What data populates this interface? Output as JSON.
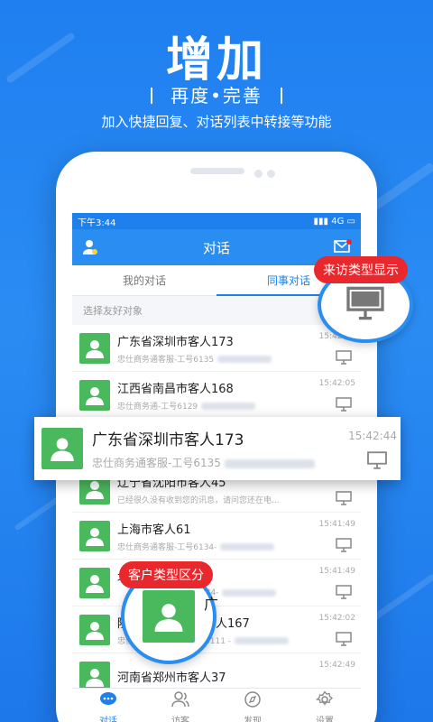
{
  "promo": {
    "title": "增加",
    "subtitle": "再度•完善",
    "description": "加入快捷回复、对话列表中转接等功能"
  },
  "status": {
    "time": "下午3:44",
    "network": "4G"
  },
  "appbar": {
    "title": "对话"
  },
  "tabs": [
    {
      "label": "我的对话",
      "active": false
    },
    {
      "label": "同事对话",
      "active": true
    }
  ],
  "filter": {
    "placeholder": "选择友好对象"
  },
  "conversations": [
    {
      "name": "广东省深圳市客人173",
      "detail": "忠仕商务通客服-工号6135",
      "time": "15:42:44"
    },
    {
      "name": "江西省南昌市客人168",
      "detail": "忠仕商务通-工号6129",
      "time": "15:42:05"
    },
    {
      "name": "辽宁省沈阳市客人45",
      "detail": "已经很久没有收到您的讯息，请问您还在电...",
      "time": "15:42:21"
    },
    {
      "name": "上海市客人61",
      "detail": "忠仕商务通客服-工号6134-",
      "time": "15:41:49"
    },
    {
      "name": "北",
      "detail": "",
      "time": "15:41:49"
    },
    {
      "name": "陕",
      "detail": "忠仕商",
      "time": "15:42:02"
    },
    {
      "name": "河南省郑州市客人37",
      "detail": "",
      "time": "15:42:49"
    }
  ],
  "highlight": {
    "name": "广东省深圳市客人173",
    "detail": "忠仕商务通客服-工号6135",
    "time": "15:42:44"
  },
  "callouts": {
    "visitor_type": "来访类型显示",
    "customer_type": "客户类型区分"
  },
  "bubble_fragments": {
    "row5_tail": "广",
    "row6_tail": "人167",
    "row6_detail_tail": "6111 -"
  },
  "nav": [
    {
      "label": "对话",
      "icon": "chat-icon",
      "active": true
    },
    {
      "label": "访客",
      "icon": "visitors-icon",
      "active": false
    },
    {
      "label": "发现",
      "icon": "compass-icon",
      "active": false
    },
    {
      "label": "设置",
      "icon": "gear-icon",
      "active": false
    }
  ],
  "colors": {
    "primary": "#2a8df2",
    "avatar_green": "#4ab85c",
    "callout_red": "#e8282c"
  }
}
